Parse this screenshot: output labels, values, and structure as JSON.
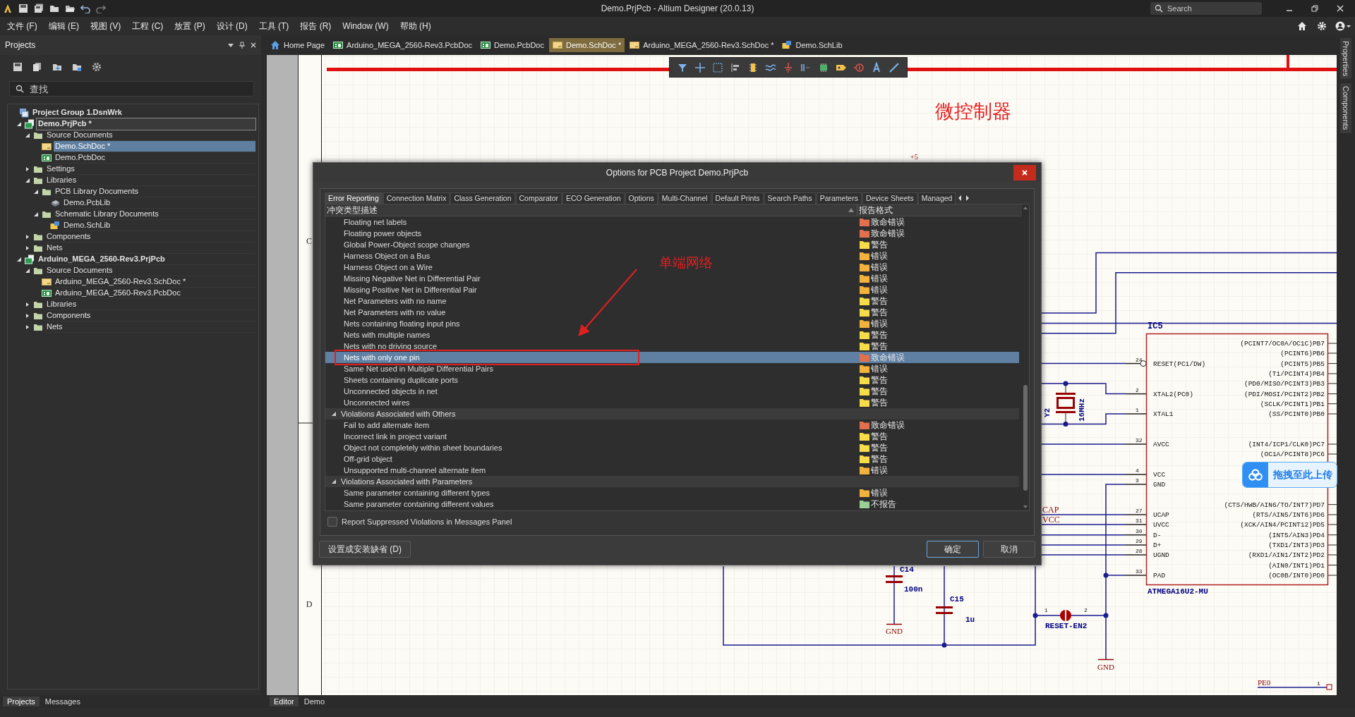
{
  "title_bar": {
    "title": "Demo.PrjPcb - Altium Designer (20.0.13)",
    "search_placeholder": "Search"
  },
  "menu": [
    "文件 (F)",
    "编辑 (E)",
    "视图 (V)",
    "工程 (C)",
    "放置 (P)",
    "设计 (D)",
    "工具 (T)",
    "报告 (R)",
    "Window (W)",
    "帮助 (H)"
  ],
  "projects_panel": {
    "title": "Projects",
    "search_placeholder": "查找",
    "tree": [
      {
        "label": "Project Group 1.DsnWrk",
        "kind": "group",
        "selected": false,
        "focused": false,
        "children": [
          {
            "label": "Demo.PrjPcb *",
            "kind": "project",
            "expanded": true,
            "selected": false,
            "focused": true,
            "children": [
              {
                "label": "Source Documents",
                "kind": "folder",
                "expanded": true,
                "selected": false,
                "focused": false,
                "children": [
                  {
                    "label": "Demo.SchDoc *",
                    "kind": "schdoc",
                    "selected": true,
                    "focused": false
                  },
                  {
                    "label": "Demo.PcbDoc",
                    "kind": "pcbdoc",
                    "selected": false,
                    "focused": false
                  }
                ]
              },
              {
                "label": "Settings",
                "kind": "folder",
                "expanded": false,
                "selected": false,
                "focused": false
              },
              {
                "label": "Libraries",
                "kind": "folder",
                "expanded": true,
                "selected": false,
                "focused": false,
                "children": [
                  {
                    "label": "PCB Library Documents",
                    "kind": "folder",
                    "expanded": true,
                    "selected": false,
                    "focused": false,
                    "children": [
                      {
                        "label": "Demo.PcbLib",
                        "kind": "pcblib",
                        "selected": false,
                        "focused": false
                      }
                    ]
                  },
                  {
                    "label": "Schematic Library Documents",
                    "kind": "folder",
                    "expanded": true,
                    "selected": false,
                    "focused": false,
                    "children": [
                      {
                        "label": "Demo.SchLib",
                        "kind": "schlib",
                        "selected": false,
                        "focused": false
                      }
                    ]
                  }
                ]
              },
              {
                "label": "Components",
                "kind": "folder",
                "expanded": false,
                "selected": false,
                "focused": false
              },
              {
                "label": "Nets",
                "kind": "folder",
                "expanded": false,
                "selected": false,
                "focused": false
              }
            ]
          },
          {
            "label": "Arduino_MEGA_2560-Rev3.PrjPcb",
            "kind": "project",
            "expanded": true,
            "selected": false,
            "focused": false,
            "children": [
              {
                "label": "Source Documents",
                "kind": "folder",
                "expanded": true,
                "selected": false,
                "focused": false,
                "children": [
                  {
                    "label": "Arduino_MEGA_2560-Rev3.SchDoc *",
                    "kind": "schdoc",
                    "selected": false,
                    "focused": false
                  },
                  {
                    "label": "Arduino_MEGA_2560-Rev3.PcbDoc",
                    "kind": "pcbdoc",
                    "selected": false,
                    "focused": false
                  }
                ]
              },
              {
                "label": "Libraries",
                "kind": "folder",
                "expanded": false,
                "selected": false,
                "focused": false
              },
              {
                "label": "Components",
                "kind": "folder",
                "expanded": false,
                "selected": false,
                "focused": false
              },
              {
                "label": "Nets",
                "kind": "folder",
                "expanded": false,
                "selected": false,
                "focused": false
              }
            ]
          }
        ]
      }
    ]
  },
  "document_tabs": [
    {
      "label": "Home Page",
      "kind": "home",
      "selected": false
    },
    {
      "label": "Arduino_MEGA_2560-Rev3.PcbDoc",
      "kind": "pcbdoc",
      "selected": false
    },
    {
      "label": "Demo.PcbDoc",
      "kind": "pcbdoc",
      "selected": false
    },
    {
      "label": "Demo.SchDoc *",
      "kind": "schdoc",
      "selected": true
    },
    {
      "label": "Arduino_MEGA_2560-Rev3.SchDoc *",
      "kind": "schdoc",
      "selected": false
    },
    {
      "label": "Demo.SchLib",
      "kind": "schlib",
      "selected": false
    }
  ],
  "schematic": {
    "title": "微控制器",
    "power_label": "+5",
    "zone_labels": [
      "C",
      "D"
    ],
    "ic": {
      "designator": "IC5",
      "part": "ATMEGA16U2-MU",
      "left_pins": [
        {
          "number": "24",
          "name": "RESET(PC1/DW)",
          "inverted": true
        },
        {
          "number": "2",
          "name": "XTAL2(PC0)",
          "inverted": false
        },
        {
          "number": "1",
          "name": "XTAL1",
          "inverted": false
        },
        {
          "number": "32",
          "name": "AVCC",
          "inverted": false
        },
        {
          "number": "4",
          "name": "VCC",
          "inverted": false
        },
        {
          "number": "3",
          "name": "GND",
          "inverted": false
        },
        {
          "number": "27",
          "name": "UCAP",
          "inverted": false
        },
        {
          "number": "31",
          "name": "UVCC",
          "inverted": false
        },
        {
          "number": "30",
          "name": "D-",
          "inverted": false
        },
        {
          "number": "29",
          "name": "D+",
          "inverted": false
        },
        {
          "number": "28",
          "name": "UGND",
          "inverted": false
        },
        {
          "number": "33",
          "name": "PAD",
          "inverted": false
        }
      ],
      "right_pins": [
        "(PCINT7/OC0A/OC1C)PB7",
        "(PCINT6)PB6",
        "(PCINT5)PB5",
        "(T1/PCINT4)PB4",
        "(PD0/MISO/PCINT3)PB3",
        "(PDI/MOSI/PCINT2)PB2",
        "(SCLK/PCINT1)PB1",
        "(SS/PCINT0)PB0",
        "(INT4/ICP1/CLK0)PC7",
        "(OC1A/PCINT8)PC6",
        "(CTS/HWB/AIN6/TO/INT7)PD7",
        "(RTS/AIN5/INT6)PD6",
        "(XCK/AIN4/PCINT12)PD5",
        "(INT5/AIN3)PD4",
        "(TXD1/INT3)PD3",
        "(RXD1/AIN1/INT2)PD2",
        "(AIN0/INT1)PD1",
        "(OC0B/INT0)PD0"
      ]
    },
    "crystal": {
      "designator": "Y2",
      "value": "16MHz"
    },
    "capacitors": [
      {
        "designator": "C14",
        "value": "100n"
      },
      {
        "designator": "C15",
        "value": "1u"
      }
    ],
    "jumper": {
      "designator": "RESET-EN2",
      "pins": [
        "1",
        "2"
      ]
    },
    "net_labels": [
      "CAP",
      "VCC"
    ],
    "ground_labels": [
      "GND",
      "GND"
    ],
    "port": {
      "label": "PE0",
      "pin": "1"
    }
  },
  "dialog": {
    "title": "Options for PCB Project Demo.PrjPcb",
    "tabs": [
      {
        "label": "Error Reporting",
        "selected": true
      },
      {
        "label": "Connection Matrix",
        "selected": false
      },
      {
        "label": "Class Generation",
        "selected": false
      },
      {
        "label": "Comparator",
        "selected": false
      },
      {
        "label": "ECO Generation",
        "selected": false
      },
      {
        "label": "Options",
        "selected": false
      },
      {
        "label": "Multi-Channel",
        "selected": false
      },
      {
        "label": "Default Prints",
        "selected": false
      },
      {
        "label": "Search Paths",
        "selected": false
      },
      {
        "label": "Parameters",
        "selected": false
      },
      {
        "label": "Device Sheets",
        "selected": false
      },
      {
        "label": "Managed",
        "selected": false
      }
    ],
    "columns": [
      "冲突类型描述",
      "报告格式"
    ],
    "groups": [
      {
        "items": [
          {
            "name": "Floating net labels",
            "report": "致命错误",
            "color": "#e2704e",
            "selected": false
          },
          {
            "name": "Floating power objects",
            "report": "致命错误",
            "color": "#e2704e",
            "selected": false
          },
          {
            "name": "Global Power-Object scope changes",
            "report": "警告",
            "color": "#f6dc48",
            "selected": false
          },
          {
            "name": "Harness Object on a Bus",
            "report": "错误",
            "color": "#f2b33d",
            "selected": false
          },
          {
            "name": "Harness Object on a Wire",
            "report": "错误",
            "color": "#f2b33d",
            "selected": false
          },
          {
            "name": "Missing Negative Net in Differential Pair",
            "report": "错误",
            "color": "#f2b33d",
            "selected": false
          },
          {
            "name": "Missing Positive Net in Differential Pair",
            "report": "错误",
            "color": "#f2b33d",
            "selected": false
          },
          {
            "name": "Net Parameters with no name",
            "report": "警告",
            "color": "#f6dc48",
            "selected": false
          },
          {
            "name": "Net Parameters with no value",
            "report": "警告",
            "color": "#f6dc48",
            "selected": false
          },
          {
            "name": "Nets containing floating input pins",
            "report": "错误",
            "color": "#f2b33d",
            "selected": false
          },
          {
            "name": "Nets with multiple names",
            "report": "警告",
            "color": "#f6dc48",
            "selected": false
          },
          {
            "name": "Nets with no driving source",
            "report": "警告",
            "color": "#f6dc48",
            "selected": false
          },
          {
            "name": "Nets with only one pin",
            "report": "致命错误",
            "color": "#e2704e",
            "selected": true
          },
          {
            "name": "Same Net used in Multiple Differential Pairs",
            "report": "错误",
            "color": "#f2b33d",
            "selected": false
          },
          {
            "name": "Sheets containing duplicate ports",
            "report": "警告",
            "color": "#f6dc48",
            "selected": false
          },
          {
            "name": "Unconnected objects in net",
            "report": "警告",
            "color": "#f6dc48",
            "selected": false
          },
          {
            "name": "Unconnected wires",
            "report": "警告",
            "color": "#f6dc48",
            "selected": false
          }
        ]
      },
      {
        "title": "Violations Associated with Others",
        "expanded": true,
        "items": [
          {
            "name": "Fail to add alternate item",
            "report": "致命错误",
            "color": "#e2704e",
            "selected": false
          },
          {
            "name": "Incorrect link in project variant",
            "report": "警告",
            "color": "#f6dc48",
            "selected": false
          },
          {
            "name": "Object not completely within sheet boundaries",
            "report": "警告",
            "color": "#f6dc48",
            "selected": false
          },
          {
            "name": "Off-grid object",
            "report": "警告",
            "color": "#f6dc48",
            "selected": false
          },
          {
            "name": "Unsupported multi-channel alternate item",
            "report": "错误",
            "color": "#f2b33d",
            "selected": false
          }
        ]
      },
      {
        "title": "Violations Associated with Parameters",
        "expanded": true,
        "items": [
          {
            "name": "Same parameter containing different types",
            "report": "错误",
            "color": "#f2b33d",
            "selected": false
          },
          {
            "name": "Same parameter containing different values",
            "report": "不报告",
            "color": "#9ccf96",
            "selected": false
          }
        ]
      }
    ],
    "suppressed_checkbox": {
      "label": "Report Suppressed Violations in Messages Panel",
      "checked": false
    },
    "buttons": [
      {
        "label": "设置成安装缺省 (D)",
        "default": false
      },
      {
        "label": "确定",
        "default": true
      },
      {
        "label": "取消",
        "default": false
      }
    ]
  },
  "annotation": {
    "text": "单端网络"
  },
  "upload_widget": {
    "label": "拖拽至此上传"
  },
  "side_tabs": [
    "Properties",
    "Components"
  ],
  "panel_tabs": [
    {
      "label": "Projects",
      "selected": true
    },
    {
      "label": "Messages",
      "selected": false
    }
  ],
  "editor_tabs": [
    {
      "label": "Editor",
      "selected": true
    },
    {
      "label": "Demo",
      "selected": false
    }
  ]
}
